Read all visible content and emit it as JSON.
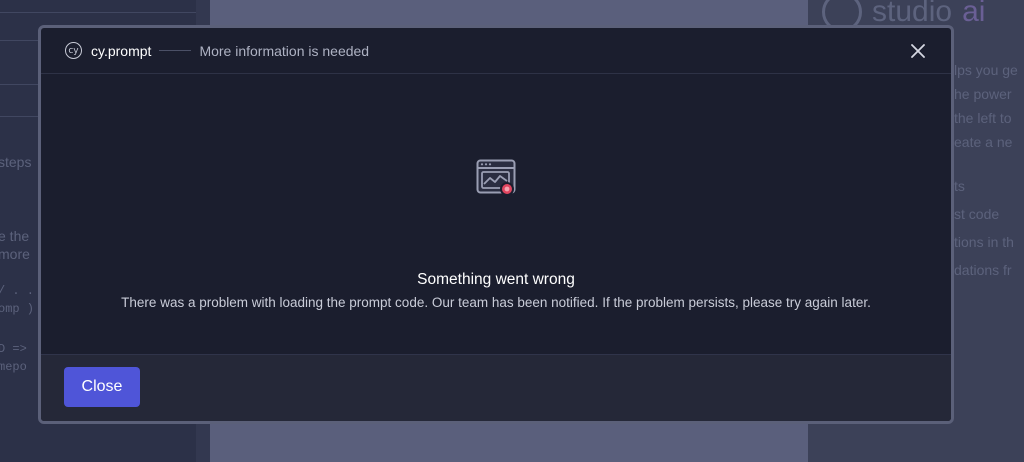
{
  "background": {
    "right_panel": {
      "logo_text": "studio",
      "logo_suffix": "ai",
      "fragments": [
        "lps you ge",
        "he power",
        "the left to",
        "eate a ne",
        "ts",
        "st code",
        "tions in th",
        "dations fr"
      ]
    },
    "left_panel": {
      "fragments": [
        "steps",
        "e the",
        "more",
        "/ . . (",
        "omp )",
        "D =>",
        "mepo"
      ]
    }
  },
  "modal": {
    "header": {
      "logo_text": "cy",
      "title": "cy.prompt",
      "subtitle": "More information is needed",
      "close_icon": "close-icon"
    },
    "body": {
      "illustration_icon": "browser-error-icon",
      "error_title": "Something went wrong",
      "error_message": "There was a problem with loading the prompt code. Our team has been notified. If the problem persists, please try again later."
    },
    "footer": {
      "close_label": "Close"
    }
  },
  "colors": {
    "modal_background": "#1b1e2e",
    "accent": "#4f55d8",
    "error_badge": "#e0455f"
  }
}
